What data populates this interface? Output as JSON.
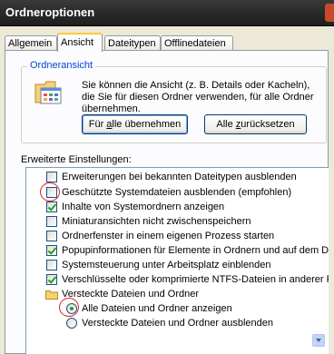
{
  "window": {
    "title": "Ordneroptionen"
  },
  "tabs": [
    {
      "label": "Allgemein"
    },
    {
      "label": "Ansicht"
    },
    {
      "label": "Dateitypen"
    },
    {
      "label": "Offlinedateien"
    }
  ],
  "folder_view": {
    "legend": "Ordneransicht",
    "description": "Sie können die Ansicht (z. B. Details oder Kacheln), die Sie für diesen Ordner verwenden, für alle Ordner übernehmen.",
    "apply_button": {
      "before": "Für ",
      "accel": "a",
      "after": "lle übernehmen"
    },
    "reset_button": {
      "before": "Alle ",
      "accel": "z",
      "after": "urücksetzen"
    }
  },
  "advanced": {
    "label": "Erweiterte Einstellungen:",
    "items": [
      {
        "label": "Erweiterungen bei bekannten Dateitypen ausblenden",
        "checked": false
      },
      {
        "label": "Geschützte Systemdateien ausblenden (empfohlen)",
        "checked": false
      },
      {
        "label": "Inhalte von Systemordnern anzeigen",
        "checked": true
      },
      {
        "label": "Miniaturansichten nicht zwischenspeichern",
        "checked": false
      },
      {
        "label": "Ordnerfenster in einem eigenen Prozess starten",
        "checked": false
      },
      {
        "label": "Popupinformationen für Elemente in Ordnern und auf dem Des",
        "checked": true
      },
      {
        "label": "Systemsteuerung unter Arbeitsplatz einblenden",
        "checked": false
      },
      {
        "label": "Verschlüsselte oder komprimierte NTFS-Dateien in anderer Far",
        "checked": true
      },
      {
        "label": "Versteckte Dateien und Ordner"
      },
      {
        "label": "Alle Dateien und Ordner anzeigen",
        "selected": true
      },
      {
        "label": "Versteckte Dateien und Ordner ausblenden",
        "selected": false
      }
    ]
  },
  "colors": {
    "highlight_circle": "#E02020",
    "accent_tab": "#FFC83C",
    "legend_text": "#0046D5"
  }
}
